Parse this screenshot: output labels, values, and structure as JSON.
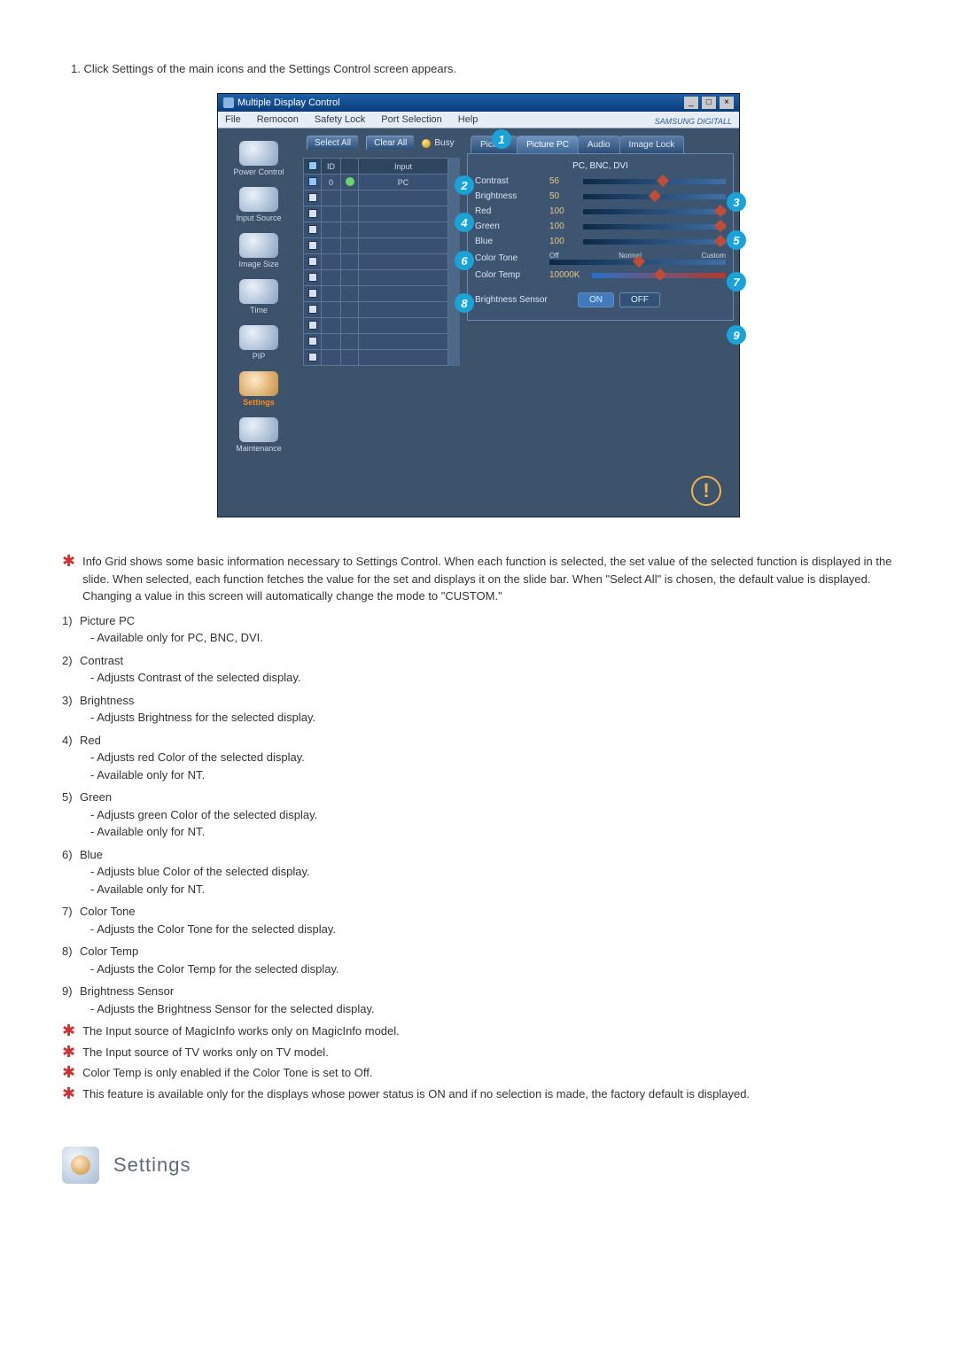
{
  "intro_step": "1.  Click Settings of the main icons and the Settings Control screen appears.",
  "app": {
    "title": "Multiple Display Control",
    "menu": [
      "File",
      "Remocon",
      "Safety Lock",
      "Port Selection",
      "Help"
    ],
    "brand": "SAMSUNG DIGITALL"
  },
  "sidebar": {
    "items": [
      {
        "label": "Power Control"
      },
      {
        "label": "Input Source"
      },
      {
        "label": "Image Size"
      },
      {
        "label": "Time"
      },
      {
        "label": "PIP"
      },
      {
        "label": "Settings",
        "selected": true
      },
      {
        "label": "Maintenance"
      }
    ]
  },
  "toolbar": {
    "select_all": "Select All",
    "clear_all": "Clear All",
    "busy": "Busy"
  },
  "grid": {
    "headers": {
      "chk": "",
      "id": "ID",
      "status": "",
      "input": "Input"
    },
    "rows": [
      {
        "checked": true,
        "id": "0",
        "status": "on",
        "input": "PC"
      },
      {
        "checked": false
      },
      {
        "checked": false
      },
      {
        "checked": false
      },
      {
        "checked": false
      },
      {
        "checked": false
      },
      {
        "checked": false
      },
      {
        "checked": false
      },
      {
        "checked": false
      },
      {
        "checked": false
      },
      {
        "checked": false
      },
      {
        "checked": false
      }
    ]
  },
  "tabs": [
    "Picture",
    "Picture PC",
    "Audio",
    "Image Lock"
  ],
  "panel": {
    "subtitle": "PC, BNC, DVI",
    "contrast": {
      "label": "Contrast",
      "value": "56"
    },
    "brightness": {
      "label": "Brightness",
      "value": "50"
    },
    "red": {
      "label": "Red",
      "value": "100"
    },
    "green": {
      "label": "Green",
      "value": "100"
    },
    "blue": {
      "label": "Blue",
      "value": "100"
    },
    "colortone": {
      "label": "Color Tone",
      "opts": [
        "Off",
        "Normal",
        "Custom"
      ]
    },
    "colortemp": {
      "label": "Color Temp",
      "value": "10000K"
    },
    "bsensor": {
      "label": "Brightness Sensor",
      "on": "ON",
      "off": "OFF"
    }
  },
  "callouts": [
    "1",
    "2",
    "3",
    "4",
    "5",
    "6",
    "7",
    "8",
    "9"
  ],
  "notes": {
    "intro_star": "Info Grid shows some basic information necessary to Settings Control. When each function is selected, the set value of the selected function is displayed in the slide. When selected, each function fetches the value for the set and displays it on the slide bar. When \"Select All\" is chosen, the default value is displayed. Changing a value in this screen will automatically change the mode to \"CUSTOM.\"",
    "list": [
      {
        "n": "1)",
        "name": "Picture PC",
        "sub": [
          "Available only for PC, BNC, DVI."
        ]
      },
      {
        "n": "2)",
        "name": "Contrast",
        "sub": [
          "Adjusts Contrast of the selected display."
        ]
      },
      {
        "n": "3)",
        "name": "Brightness",
        "sub": [
          "Adjusts Brightness for the selected display."
        ]
      },
      {
        "n": "4)",
        "name": "Red",
        "sub": [
          "Adjusts red Color of the selected display.",
          "Available  only for NT."
        ]
      },
      {
        "n": "5)",
        "name": "Green",
        "sub": [
          "Adjusts green Color of the selected display.",
          "Available  only for NT."
        ]
      },
      {
        "n": "6)",
        "name": "Blue",
        "sub": [
          "Adjusts blue Color of the selected display.",
          "Available  only for NT."
        ]
      },
      {
        "n": "7)",
        "name": "Color Tone",
        "sub": [
          "Adjusts the Color Tone for the selected display."
        ]
      },
      {
        "n": "8)",
        "name": "Color Temp",
        "sub": [
          "Adjusts the Color Temp for the selected display."
        ]
      },
      {
        "n": "9)",
        "name": "Brightness Sensor",
        "sub": [
          "Adjusts the Brightness Sensor for the selected display."
        ]
      }
    ],
    "stars": [
      "The Input source of MagicInfo works only on MagicInfo model.",
      "The Input source of TV works only on TV model.",
      "Color Temp is only enabled if the Color Tone is set to Off.",
      "This feature is available only for the displays whose power status is ON and if no selection is made, the factory default is displayed."
    ]
  },
  "section_heading": "Settings"
}
